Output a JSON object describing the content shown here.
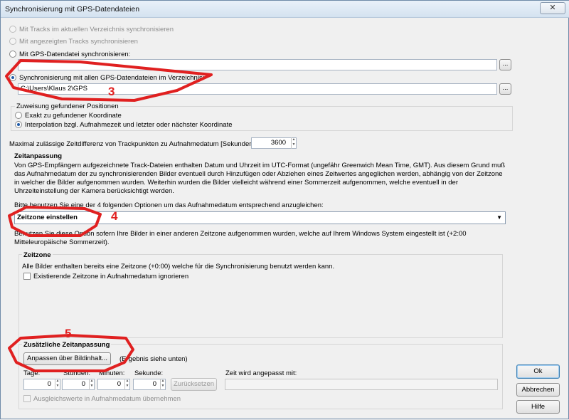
{
  "window": {
    "title": "Synchronisierung mit GPS-Datendateien",
    "close_label": "✕"
  },
  "sync_options": {
    "opt_current_dir": "Mit Tracks im aktuellen Verzeichnis synchronisieren",
    "opt_shown_tracks": "Mit angezeigten Tracks synchronisieren",
    "opt_gps_file": "Mit GPS-Datendatei synchronisieren:",
    "gps_file_value": "",
    "browse_label": "...",
    "opt_all_gps_dir": "Synchronisierung mit allen GPS-Datendateien im Verzeichnis:",
    "gps_dir_value": "C:\\Users\\Klaus 2\\GPS",
    "browse2_label": "..."
  },
  "assignment": {
    "heading": "Zuweisung gefundener Positionen",
    "opt_exact": "Exakt zu gefundener Koordinate",
    "opt_interp": "Interpolation bzgl. Aufnahmezeit und letzter oder nächster Koordinate"
  },
  "max_diff": {
    "label": "Maximal zulässige Zeitdifferenz von Trackpunkten zu Aufnahmedatum [Sekunden]:",
    "value": "3600"
  },
  "zeitanpassung": {
    "heading": "Zeitanpassung",
    "description": "Von GPS-Empfängern aufgezeichnete Track-Dateien enthalten Datum und Uhrzeit im UTC-Format (ungefähr Greenwich Mean Time, GMT). Aus diesem Grund muß das Aufnahmedatum der zu synchronisierenden Bilder eventuell durch Hinzufügen oder Abziehen eines Zeitwertes angeglichen werden, abhängig von der Zeitzone in welcher die Bilder aufgenommen wurden. Weiterhin wurden die Bilder vielleicht während einer Sommerzeit aufgenommen, welche eventuell in der Uhrzeiteinstellung der Kamera berücksichtigt werden.",
    "choose_label": "Bitte benutzen Sie eine der 4 folgenden Optionen um das Aufnahmedatum entsprechend anzugleichen:",
    "dropdown_value": "Zeitzone einstellen",
    "option_description": "Benutzen Sie diese Option sofern Ihre Bilder in einer anderen Zeitzone aufgenommen wurden, welche auf Ihrem Windows System eingestellt ist (+2:00 Mitteleuropäische Sommerzeit)."
  },
  "zeitzone": {
    "heading": "Zeitzone",
    "text": "Alle Bilder enthalten bereits eine Zeitzone (+0:00) welche für die Synchronisierung benutzt werden kann.",
    "ignore_label": "Existierende Zeitzone in Aufnahmedatum ignorieren"
  },
  "extra": {
    "heading": "Zusätzliche Zeitanpassung",
    "adjust_button": "Anpassen über Bildinhalt...",
    "result_hint": "(Ergebnis siehe unten)",
    "days_label": "Tage:",
    "days_value": "0",
    "hours_label": "Stunden:",
    "hours_value": "0",
    "minutes_label": "Minuten:",
    "minutes_value": "0",
    "seconds_label": "Sekunde:",
    "seconds_value": "0",
    "reset_button": "Zurücksetzen",
    "adjusted_label": "Zeit wird angepasst mit:",
    "adjusted_value": "",
    "apply_label": "Ausgleichswerte in Aufnahmedatum übernehmen"
  },
  "buttons": {
    "ok": "Ok",
    "cancel": "Abbrechen",
    "help": "Hilfe"
  },
  "annotations": {
    "n3": "3",
    "n4": "4",
    "n5": "5",
    "color": "#e02020"
  },
  "icons": {
    "spin_up": "▲",
    "spin_down": "▼",
    "dropdown_arrow": "▼"
  }
}
